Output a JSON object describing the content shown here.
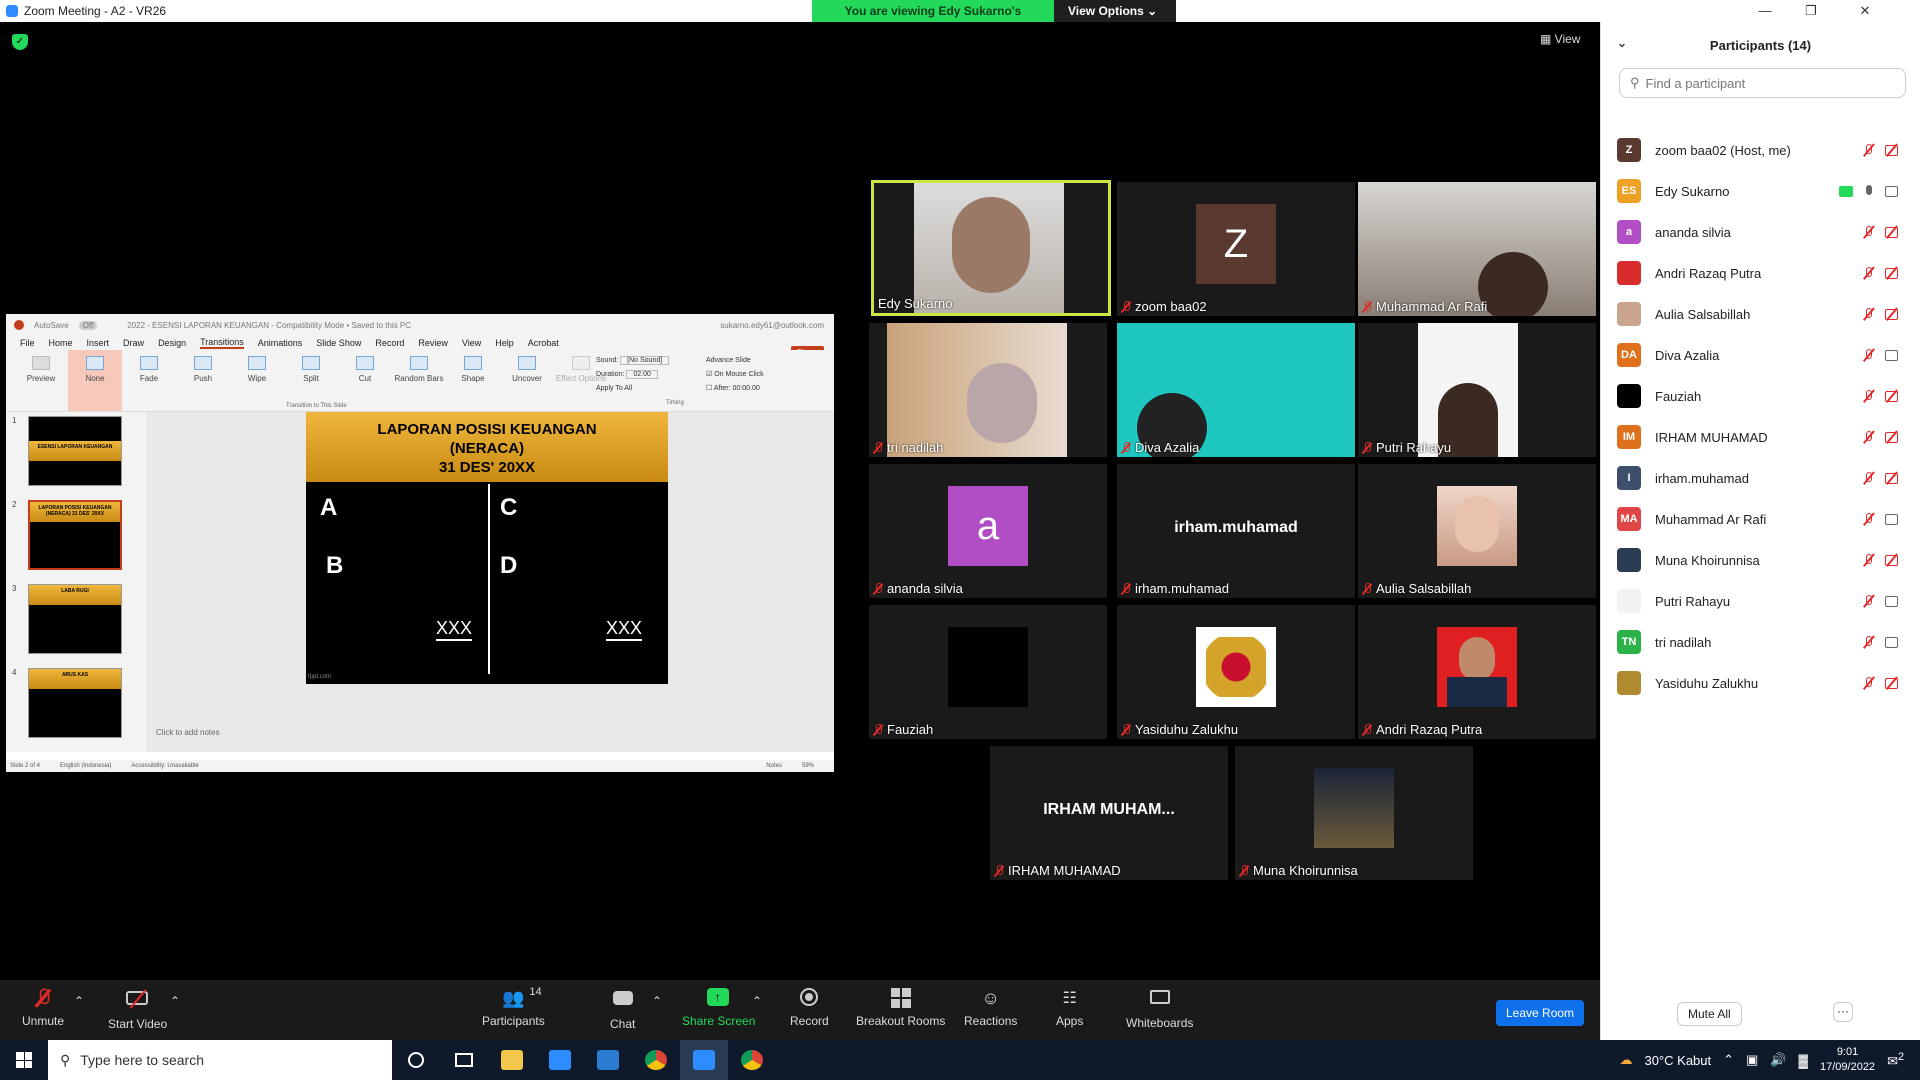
{
  "window": {
    "title": "Zoom Meeting - A2 - VR26"
  },
  "banner": {
    "message": "You are viewing Edy Sukarno's screen",
    "view_options": "View Options"
  },
  "stage": {
    "view_label": "View"
  },
  "ppt": {
    "title_bar": {
      "autosave": "AutoSave",
      "autosave_state": "Off",
      "doc_title": "2022 - ESENSI LAPORAN KEUANGAN  -  Compatibility Mode • Saved to this PC",
      "account": "sukarno.edy61@outlook.com"
    },
    "menu": [
      "File",
      "Home",
      "Insert",
      "Draw",
      "Design",
      "Transitions",
      "Animations",
      "Slide Show",
      "Record",
      "Review",
      "View",
      "Help",
      "Acrobat"
    ],
    "active_menu": "Transitions",
    "share_label": "Share",
    "preview_label": "Preview",
    "transitions": [
      "None",
      "Fade",
      "Push",
      "Wipe",
      "Split",
      "Cut",
      "Random Bars",
      "Shape",
      "Uncover"
    ],
    "effect_options": "Effect Options",
    "group_label": "Transition to This Slide",
    "timing": {
      "sound_label": "Sound:",
      "sound_value": "[No Sound]",
      "duration_label": "Duration:",
      "duration_value": "02.00",
      "apply_all": "Apply To All",
      "group": "Timing"
    },
    "advance": {
      "title": "Advance Slide",
      "on_click": "On Mouse Click",
      "after": "After:",
      "after_value": "00:00.00"
    },
    "thumb_numbers": [
      "1",
      "2",
      "3",
      "4"
    ],
    "thumb_titles": [
      "ESENSI LAPORAN KEUANGAN",
      "LAPORAN POSISI KEUANGAN (NERACA) 31 DES' 20XX",
      "LABA RUGI",
      "ARUS KAS"
    ],
    "slide": {
      "line1": "LAPORAN POSISI KEUANGAN",
      "line2": "(NERACA)",
      "line3": "31 DES' 20XX",
      "a": "A",
      "b": "B",
      "c": "C",
      "d": "D",
      "xxx_left": "XXX",
      "xxx_right": "XXX",
      "footer": "fppt.com"
    },
    "notes": "Click to add notes",
    "status": {
      "slide": "Slide 2 of 4",
      "lang": "English (Indonesia)",
      "access": "Accessibility: Unavailable",
      "notes_btn": "Notes",
      "zoom": "59%"
    }
  },
  "tiles": [
    {
      "name": "Edy Sukarno",
      "muted": false,
      "kind": "video"
    },
    {
      "name": "zoom baa02",
      "muted": true,
      "kind": "avatar",
      "initial": "Z",
      "color": "#5a3a30"
    },
    {
      "name": "Muhammad Ar Rafi",
      "muted": true,
      "kind": "video"
    },
    {
      "name": "tri nadilah",
      "muted": true,
      "kind": "video"
    },
    {
      "name": "Diva Azalia",
      "muted": true,
      "kind": "video"
    },
    {
      "name": "Putri Rahayu",
      "muted": true,
      "kind": "photo"
    },
    {
      "name": "ananda silvia",
      "muted": true,
      "kind": "avatar",
      "initial": "a",
      "color": "#b14ec6"
    },
    {
      "name": "irham.muhamad",
      "muted": true,
      "kind": "text",
      "center": "irham.muhamad"
    },
    {
      "name": "Aulia Salsabillah",
      "muted": true,
      "kind": "photo"
    },
    {
      "name": "Fauziah",
      "muted": true,
      "kind": "photo"
    },
    {
      "name": "Yasiduhu Zalukhu",
      "muted": true,
      "kind": "photo"
    },
    {
      "name": "Andri Razaq Putra",
      "muted": true,
      "kind": "photo"
    },
    {
      "name": "IRHAM MUHAMAD",
      "muted": true,
      "kind": "text",
      "center": "IRHAM  MUHAM..."
    },
    {
      "name": "Muna Khoirunnisa",
      "muted": true,
      "kind": "photo"
    }
  ],
  "toolbar": {
    "unmute": "Unmute",
    "start_video": "Start Video",
    "participants": "Participants",
    "participants_count": "14",
    "chat": "Chat",
    "share_screen": "Share Screen",
    "record": "Record",
    "breakout": "Breakout Rooms",
    "reactions": "Reactions",
    "apps": "Apps",
    "whiteboards": "Whiteboards",
    "leave": "Leave Room"
  },
  "panel": {
    "title": "Participants (14)",
    "search_placeholder": "Find a participant",
    "participants": [
      {
        "name": "zoom baa02 (Host, me)",
        "initials": "Z",
        "color": "#5a3a30",
        "mic": "off",
        "cam": "off",
        "share": false
      },
      {
        "name": "Edy Sukarno",
        "initials": "ES",
        "color": "#f0a024",
        "mic": "on",
        "cam": "on",
        "share": true
      },
      {
        "name": "ananda silvia",
        "initials": "a",
        "color": "#b14ec6",
        "mic": "off",
        "cam": "off",
        "share": false
      },
      {
        "name": "Andri Razaq Putra",
        "initials": "",
        "color": "#d92b2b",
        "mic": "off",
        "cam": "off",
        "share": false
      },
      {
        "name": "Aulia Salsabillah",
        "initials": "",
        "color": "#c9a58e",
        "mic": "off",
        "cam": "off",
        "share": false
      },
      {
        "name": "Diva Azalia",
        "initials": "DA",
        "color": "#e0711c",
        "mic": "off",
        "cam": "on",
        "share": false
      },
      {
        "name": "Fauziah",
        "initials": "",
        "color": "#000000",
        "mic": "off",
        "cam": "off",
        "share": false
      },
      {
        "name": "IRHAM MUHAMAD",
        "initials": "IM",
        "color": "#e0711c",
        "mic": "off",
        "cam": "off",
        "share": false
      },
      {
        "name": "irham.muhamad",
        "initials": "I",
        "color": "#3d4f6b",
        "mic": "off",
        "cam": "off",
        "share": false
      },
      {
        "name": "Muhammad Ar Rafi",
        "initials": "MA",
        "color": "#e04646",
        "mic": "off",
        "cam": "on",
        "share": false
      },
      {
        "name": "Muna Khoirunnisa",
        "initials": "",
        "color": "#2b3d55",
        "mic": "off",
        "cam": "off",
        "share": false
      },
      {
        "name": "Putri Rahayu",
        "initials": "",
        "color": "#f2f2f2",
        "mic": "off",
        "cam": "on",
        "share": false
      },
      {
        "name": "tri nadilah",
        "initials": "TN",
        "color": "#2bb34a",
        "mic": "off",
        "cam": "on",
        "share": false
      },
      {
        "name": "Yasiduhu Zalukhu",
        "initials": "",
        "color": "#b08a2e",
        "mic": "off",
        "cam": "off",
        "share": false
      }
    ],
    "mute_all": "Mute All",
    "more": "···"
  },
  "taskbar": {
    "search_placeholder": "Type here to search",
    "weather": "30°C  Kabut",
    "time": "9:01",
    "date": "17/09/2022",
    "notification_count": "2"
  }
}
